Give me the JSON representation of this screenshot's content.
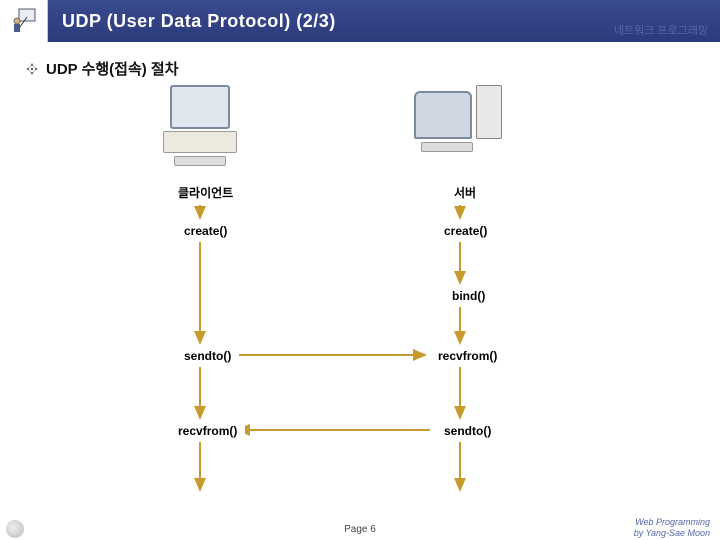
{
  "header": {
    "title": "UDP (User Data Protocol) (2/3)",
    "subtitle": "네트워크 프로그래밍"
  },
  "section": {
    "heading": "UDP 수행(접속) 절차"
  },
  "diagram": {
    "client_label": "클라이언트",
    "server_label": "서버",
    "client_steps": {
      "s1": "create()",
      "s2": "sendto()",
      "s3": "recvfrom()"
    },
    "server_steps": {
      "s1": "create()",
      "s2": "bind()",
      "s3": "recvfrom()",
      "s4": "sendto()"
    }
  },
  "footer": {
    "page": "Page 6",
    "credit_line1": "Web Programming",
    "credit_line2": "by Yang-Sae Moon"
  }
}
